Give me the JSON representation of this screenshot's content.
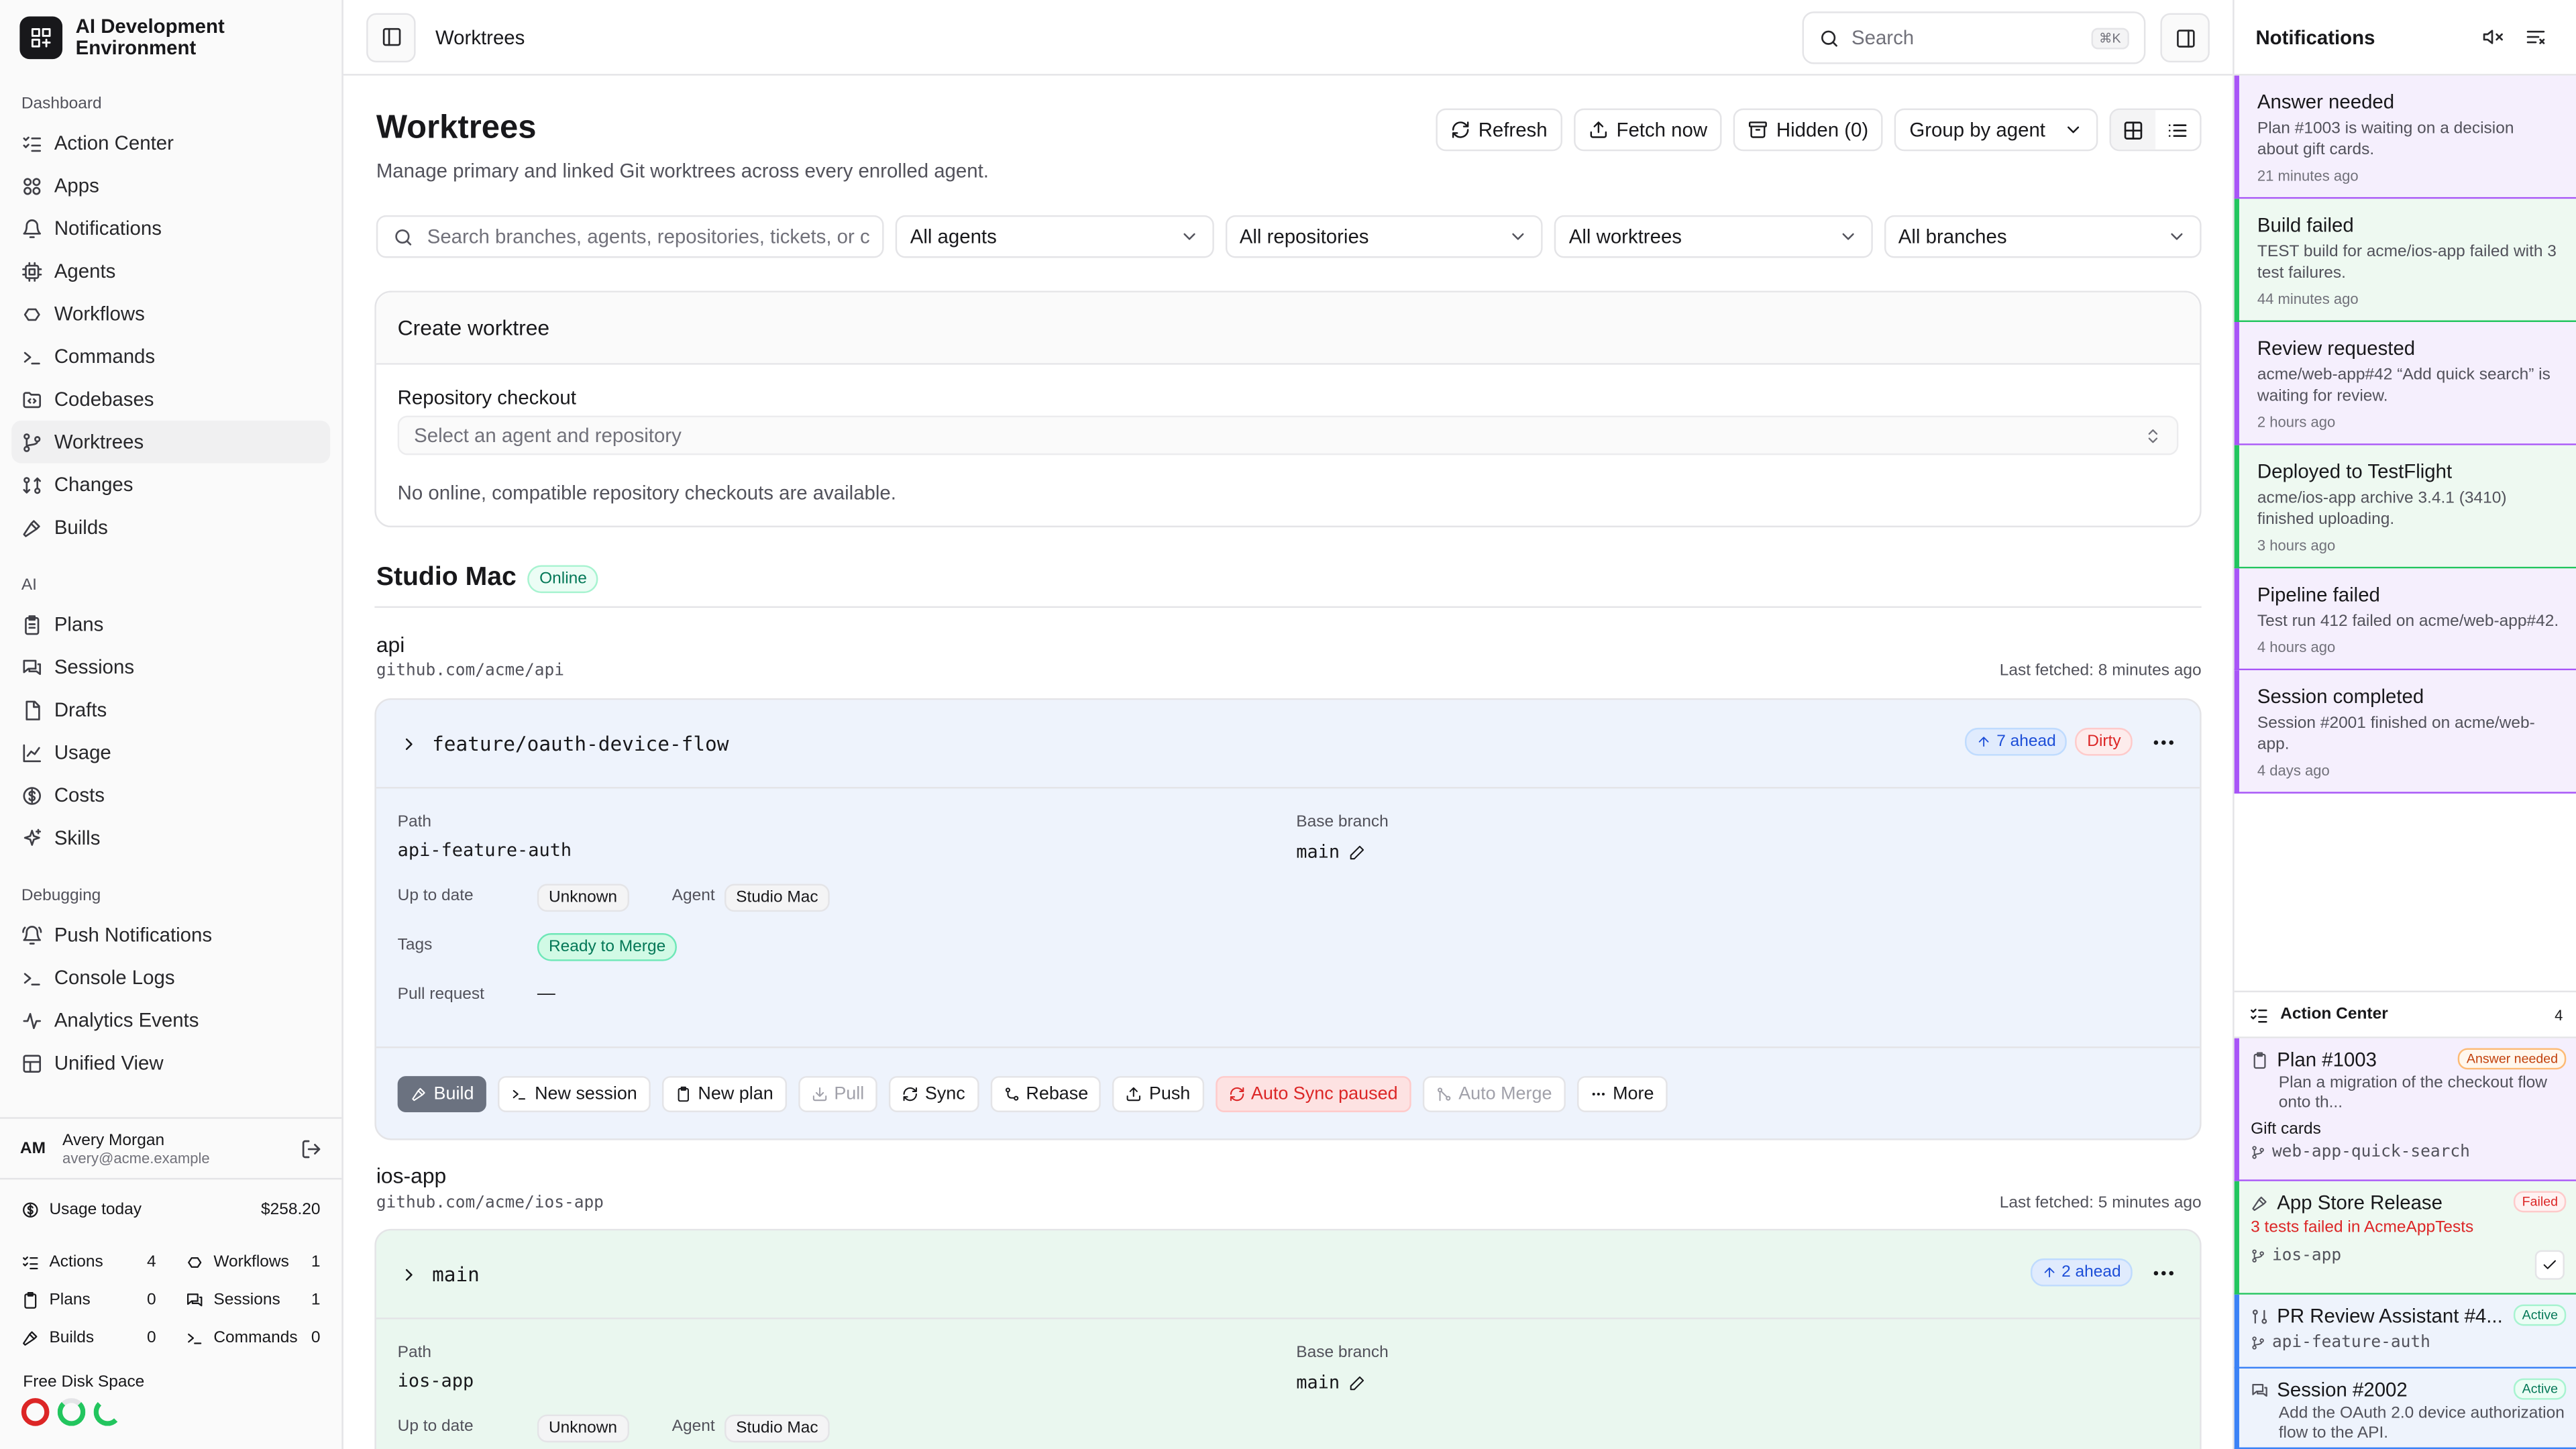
{
  "app": {
    "name": "AI Development Environment"
  },
  "sidebar": {
    "sections": [
      {
        "label": "Dashboard",
        "items": [
          {
            "label": "Action Center",
            "icon": "list-checks-icon"
          },
          {
            "label": "Apps",
            "icon": "apps-icon"
          },
          {
            "label": "Notifications",
            "icon": "bell-icon"
          },
          {
            "label": "Agents",
            "icon": "cpu-icon"
          },
          {
            "label": "Workflows",
            "icon": "workflow-icon"
          },
          {
            "label": "Commands",
            "icon": "terminal-icon"
          },
          {
            "label": "Codebases",
            "icon": "folder-code-icon"
          },
          {
            "label": "Worktrees",
            "icon": "git-branch-icon",
            "active": true
          },
          {
            "label": "Changes",
            "icon": "git-compare-icon"
          },
          {
            "label": "Builds",
            "icon": "hammer-icon"
          }
        ]
      },
      {
        "label": "AI",
        "items": [
          {
            "label": "Plans",
            "icon": "clipboard-icon"
          },
          {
            "label": "Sessions",
            "icon": "messages-icon"
          },
          {
            "label": "Drafts",
            "icon": "file-icon"
          },
          {
            "label": "Usage",
            "icon": "chart-icon"
          },
          {
            "label": "Costs",
            "icon": "dollar-icon"
          },
          {
            "label": "Skills",
            "icon": "sparkles-icon"
          }
        ]
      },
      {
        "label": "Debugging",
        "items": [
          {
            "label": "Push Notifications",
            "icon": "bell-ring-icon"
          },
          {
            "label": "Console Logs",
            "icon": "terminal-icon"
          },
          {
            "label": "Analytics Events",
            "icon": "activity-icon"
          },
          {
            "label": "Unified View",
            "icon": "layout-icon"
          }
        ]
      }
    ],
    "user": {
      "initials": "AM",
      "name": "Avery Morgan",
      "email": "avery@acme.example"
    },
    "usage": {
      "label": "Usage today",
      "value": "$258.20"
    },
    "stats": [
      {
        "label": "Actions",
        "value": "4",
        "icon": "list-checks-icon"
      },
      {
        "label": "Workflows",
        "value": "1",
        "icon": "workflow-icon"
      },
      {
        "label": "Plans",
        "value": "0",
        "icon": "clipboard-icon"
      },
      {
        "label": "Sessions",
        "value": "1",
        "icon": "messages-icon"
      },
      {
        "label": "Builds",
        "value": "0",
        "icon": "hammer-icon"
      },
      {
        "label": "Commands",
        "value": "0",
        "icon": "terminal-icon"
      }
    ],
    "disk": {
      "label": "Free Disk Space",
      "colors": [
        "#dc2626",
        "#22c55e",
        "#22c55e"
      ]
    }
  },
  "topbar": {
    "breadcrumb": "Worktrees",
    "search_placeholder": "Search",
    "search_kbd": "⌘K"
  },
  "page": {
    "title": "Worktrees",
    "subtitle": "Manage primary and linked Git worktrees across every enrolled agent.",
    "actions": {
      "refresh": "Refresh",
      "fetch": "Fetch now",
      "hidden": "Hidden (0)",
      "group": "Group by agent"
    },
    "filters": {
      "search_placeholder": "Search branches, agents, repositories, tickets, or c",
      "agents": "All agents",
      "repos": "All repositories",
      "worktrees": "All worktrees",
      "branches": "All branches"
    },
    "create": {
      "title": "Create worktree",
      "field_label": "Repository checkout",
      "field_placeholder": "Select an agent and repository",
      "note": "No online, compatible repository checkouts are available."
    },
    "group": {
      "name": "Studio Mac",
      "status": "Online"
    },
    "repos": [
      {
        "name": "api",
        "url": "github.com/acme/api",
        "fetched": "Last fetched: 8 minutes ago",
        "branch": "feature/oauth-device-flow",
        "ahead": "7 ahead",
        "dirty": "Dirty",
        "path_label": "Path",
        "path": "api-feature-auth",
        "base_label": "Base branch",
        "base": "main",
        "uptodate_label": "Up to date",
        "uptodate": "Unknown",
        "agent_label": "Agent",
        "agent": "Studio Mac",
        "tags_label": "Tags",
        "tag": "Ready to Merge",
        "pr_label": "Pull request",
        "pr": "—",
        "buttons": [
          "Build",
          "New session",
          "New plan",
          "Pull",
          "Sync",
          "Rebase",
          "Push",
          "Auto Sync paused",
          "Auto Merge",
          "More"
        ]
      },
      {
        "name": "ios-app",
        "url": "github.com/acme/ios-app",
        "fetched": "Last fetched: 5 minutes ago",
        "branch": "main",
        "ahead": "2 ahead",
        "path_label": "Path",
        "path": "ios-app",
        "base_label": "Base branch",
        "base": "main",
        "uptodate_label": "Up to date",
        "uptodate": "Unknown",
        "agent_label": "Agent",
        "agent": "Studio Mac"
      }
    ]
  },
  "notifications": {
    "title": "Notifications",
    "items": [
      {
        "title": "Answer needed",
        "body": "Plan #1003 is waiting on a decision about gift cards.",
        "time": "21 minutes ago",
        "color": "#a855f7",
        "bg": "#f5effd"
      },
      {
        "title": "Build failed",
        "body": "TEST build for acme/ios-app failed with 3 test failures.",
        "time": "44 minutes ago",
        "color": "#22c55e",
        "bg": "#eef9f1"
      },
      {
        "title": "Review requested",
        "body": "acme/web-app#42 “Add quick search” is waiting for review.",
        "time": "2 hours ago",
        "color": "#a855f7",
        "bg": "#f5effd"
      },
      {
        "title": "Deployed to TestFlight",
        "body": "acme/ios-app archive 3.4.1 (3410) finished uploading.",
        "time": "3 hours ago",
        "color": "#22c55e",
        "bg": "#eef9f1"
      },
      {
        "title": "Pipeline failed",
        "body": "Test run 412 failed on acme/web-app#42.",
        "time": "4 hours ago",
        "color": "#a855f7",
        "bg": "#f5effd"
      },
      {
        "title": "Session completed",
        "body": "Session #2001 finished on acme/web-app.",
        "time": "4 days ago",
        "color": "#a855f7",
        "bg": "#f5effd"
      }
    ],
    "action_center": {
      "title": "Action Center",
      "count": "4",
      "items": [
        {
          "title": "Plan #1003",
          "badge": "Answer needed",
          "body": "Plan a migration of the checkout flow onto th...",
          "sub": "Gift cards",
          "ref": "web-app-quick-search"
        },
        {
          "title": "App Store Release",
          "badge": "Failed",
          "body": "3 tests failed in AcmeAppTests",
          "ref": "ios-app"
        },
        {
          "title": "PR Review Assistant #4...",
          "badge": "Active",
          "ref": "api-feature-auth"
        },
        {
          "title": "Session #2002",
          "badge": "Active",
          "body": "Add the OAuth 2.0 device authorization flow to the API."
        }
      ]
    }
  }
}
